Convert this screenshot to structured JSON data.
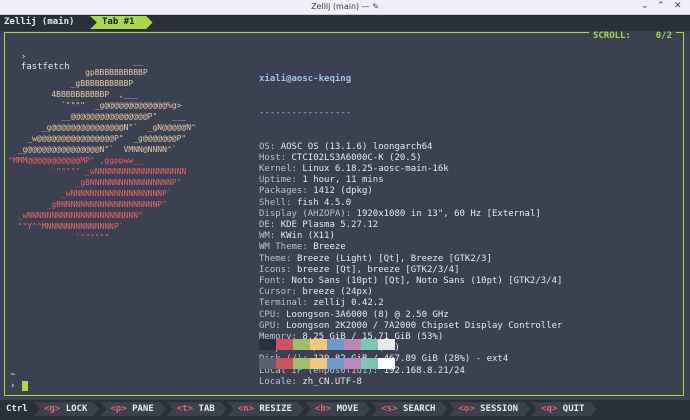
{
  "window": {
    "title": "Zellij (main) — ✎",
    "minimize": "⌄",
    "maximize": "⌃",
    "close": "✕"
  },
  "zellij": {
    "session_label": "Zellij (main)",
    "tab_label": "Tab #1",
    "scroll_label": "SCROLL:",
    "scroll_value": "0/2"
  },
  "terminal": {
    "command_prompt": "›",
    "command": "fastfetch",
    "tilde": "~",
    "final_prompt": "›"
  },
  "logo": [
    {
      "text": "                          __",
      "c": "a"
    },
    {
      "text": "                gpBBBBBBBBBBP",
      "c": "a"
    },
    {
      "text": "             _gBBBBBBBBBBP",
      "c": "a"
    },
    {
      "text": "         4BBBBBBBBBBP  ,___",
      "c": "a"
    },
    {
      "text": "           `\"\"\"\"  _g@@@@@@@@@@@@@%g>",
      "c": "a"
    },
    {
      "text": "           __@@@@@@@@@@@@@@@@P\"   ___",
      "c": "a"
    },
    {
      "text": "       _g@@@@@@@@@@@@@@@N\"`  _gN@@@@@N^",
      "c": "a"
    },
    {
      "text": "    _w@@@@@@@@@@@@@@@@P\"  _g@@@@@@@P\"",
      "c": "a"
    },
    {
      "text": "  _g@@@@@@@@@@@@@@@N\"`  VMNN@NNNN^`",
      "c": "a"
    },
    {
      "text": "^MMM@@@@@@@@@@@MP\" ,ggppww__",
      "c": "c"
    },
    {
      "text": "         `\"\"\"\"\" _wNNNNNNNNNNNNNNNNNNN",
      "c": "c"
    },
    {
      "text": "              _gBNNNNNNNNNNNNNNNNNP\"",
      "c": "c"
    },
    {
      "text": "           _wNNNNNNNNNNNNNNNNNNNP`",
      "c": "c"
    },
    {
      "text": "        _gBNNNNNNNNNNNNNNNNNNNNP\"",
      "c": "c"
    },
    {
      "text": "  _wNNNNNNNNNNNNNNNNNNNNNNN^",
      "c": "c"
    },
    {
      "text": "  \"\"Y^^MNNNNNNNNNNNNNNP`",
      "c": "c"
    },
    {
      "text": "              `\"\"\"\"\"\"",
      "c": "c"
    }
  ],
  "info": {
    "header": "xiali@aosc-keqing",
    "separator": "-----------------",
    "rows": [
      {
        "k": "OS:",
        "v": "AOSC OS (13.1.6) loongarch64"
      },
      {
        "k": "Host:",
        "v": "CTCI02LS3A6000C-K (20.5)"
      },
      {
        "k": "Kernel:",
        "v": "Linux 6.18.25-aosc-main-16k"
      },
      {
        "k": "Uptime:",
        "v": "1 hour, 11 mins"
      },
      {
        "k": "Packages:",
        "v": "1412 (dpkg)"
      },
      {
        "k": "Shell:",
        "v": "fish 4.5.0"
      },
      {
        "k": "Display (AHZOPA):",
        "v": "1920x1080 in 13\", 60 Hz [External]"
      },
      {
        "k": "DE:",
        "v": "KDE Plasma 5.27.12"
      },
      {
        "k": "WM:",
        "v": "KWin (X11)"
      },
      {
        "k": "WM Theme:",
        "v": "Breeze"
      },
      {
        "k": "Theme:",
        "v": "Breeze (Light) [Qt], Breeze [GTK2/3]"
      },
      {
        "k": "Icons:",
        "v": "breeze [Qt], breeze [GTK2/3/4]"
      },
      {
        "k": "Font:",
        "v": "Noto Sans (10pt) [Qt], Noto Sans (10pt) [GTK2/3/4]"
      },
      {
        "k": "Cursor:",
        "v": "breeze (24px)"
      },
      {
        "k": "Terminal:",
        "v": "zellij 0.42.2"
      },
      {
        "k": "CPU:",
        "v": "Loongson-3A6000 (8) @ 2.50 GHz"
      },
      {
        "k": "GPU:",
        "v": "Loongson 2K2000 / 7A2000 Chipset Display Controller"
      },
      {
        "k": "Memory:",
        "v": "8.25 GiB / 15.71 GiB (53%)"
      },
      {
        "k": "Swap:",
        "v": "0 B / 19.00 GiB (0%)"
      },
      {
        "k": "Disk (/):",
        "v": "129.82 GiB / 467.89 GiB (28%) - ext4"
      },
      {
        "k": "Local IP (enp6s0f1u1):",
        "v": "192.168.8.21/24"
      },
      {
        "k": "Locale:",
        "v": "zh_CN.UTF-8"
      }
    ]
  },
  "palette_top": [
    "#2b2f38",
    "#c95460",
    "#9fbe6a",
    "#f0c77e",
    "#6e9bc9",
    "#b888b8",
    "#7ec4b4",
    "#e8e8e8"
  ],
  "palette_bottom": [
    "#5a6070",
    "#c95460",
    "#9fbe6a",
    "#f0c77e",
    "#6e9bc9",
    "#b888b8",
    "#7ec4b4",
    "#ffffff"
  ],
  "statusbar": {
    "ctrl_label": "Ctrl",
    "keys": [
      {
        "key": "<g>",
        "label": "LOCK"
      },
      {
        "key": "<p>",
        "label": "PANE"
      },
      {
        "key": "<t>",
        "label": "TAB"
      },
      {
        "key": "<n>",
        "label": "RESIZE"
      },
      {
        "key": "<h>",
        "label": "MOVE"
      },
      {
        "key": "<s>",
        "label": "SEARCH"
      },
      {
        "key": "<o>",
        "label": "SESSION"
      },
      {
        "key": "<q>",
        "label": "QUIT"
      }
    ]
  }
}
